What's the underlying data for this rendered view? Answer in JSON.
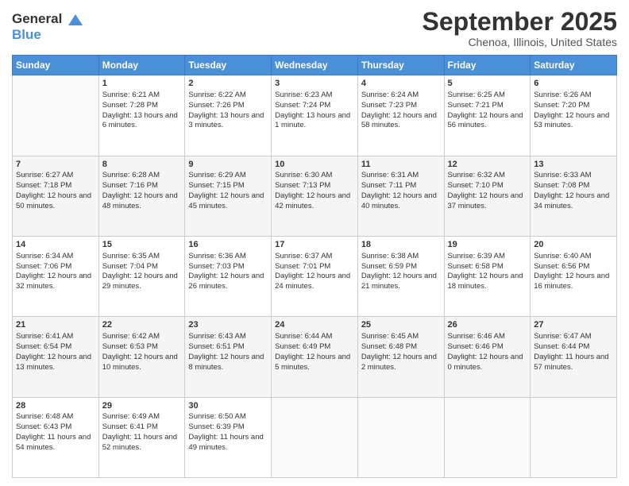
{
  "logo": {
    "line1": "General",
    "line2": "Blue"
  },
  "title": "September 2025",
  "subtitle": "Chenoa, Illinois, United States",
  "days": [
    "Sunday",
    "Monday",
    "Tuesday",
    "Wednesday",
    "Thursday",
    "Friday",
    "Saturday"
  ],
  "weeks": [
    [
      {
        "day": "",
        "sunrise": "",
        "sunset": "",
        "daylight": ""
      },
      {
        "day": "1",
        "sunrise": "Sunrise: 6:21 AM",
        "sunset": "Sunset: 7:28 PM",
        "daylight": "Daylight: 13 hours and 6 minutes."
      },
      {
        "day": "2",
        "sunrise": "Sunrise: 6:22 AM",
        "sunset": "Sunset: 7:26 PM",
        "daylight": "Daylight: 13 hours and 3 minutes."
      },
      {
        "day": "3",
        "sunrise": "Sunrise: 6:23 AM",
        "sunset": "Sunset: 7:24 PM",
        "daylight": "Daylight: 13 hours and 1 minute."
      },
      {
        "day": "4",
        "sunrise": "Sunrise: 6:24 AM",
        "sunset": "Sunset: 7:23 PM",
        "daylight": "Daylight: 12 hours and 58 minutes."
      },
      {
        "day": "5",
        "sunrise": "Sunrise: 6:25 AM",
        "sunset": "Sunset: 7:21 PM",
        "daylight": "Daylight: 12 hours and 56 minutes."
      },
      {
        "day": "6",
        "sunrise": "Sunrise: 6:26 AM",
        "sunset": "Sunset: 7:20 PM",
        "daylight": "Daylight: 12 hours and 53 minutes."
      }
    ],
    [
      {
        "day": "7",
        "sunrise": "Sunrise: 6:27 AM",
        "sunset": "Sunset: 7:18 PM",
        "daylight": "Daylight: 12 hours and 50 minutes."
      },
      {
        "day": "8",
        "sunrise": "Sunrise: 6:28 AM",
        "sunset": "Sunset: 7:16 PM",
        "daylight": "Daylight: 12 hours and 48 minutes."
      },
      {
        "day": "9",
        "sunrise": "Sunrise: 6:29 AM",
        "sunset": "Sunset: 7:15 PM",
        "daylight": "Daylight: 12 hours and 45 minutes."
      },
      {
        "day": "10",
        "sunrise": "Sunrise: 6:30 AM",
        "sunset": "Sunset: 7:13 PM",
        "daylight": "Daylight: 12 hours and 42 minutes."
      },
      {
        "day": "11",
        "sunrise": "Sunrise: 6:31 AM",
        "sunset": "Sunset: 7:11 PM",
        "daylight": "Daylight: 12 hours and 40 minutes."
      },
      {
        "day": "12",
        "sunrise": "Sunrise: 6:32 AM",
        "sunset": "Sunset: 7:10 PM",
        "daylight": "Daylight: 12 hours and 37 minutes."
      },
      {
        "day": "13",
        "sunrise": "Sunrise: 6:33 AM",
        "sunset": "Sunset: 7:08 PM",
        "daylight": "Daylight: 12 hours and 34 minutes."
      }
    ],
    [
      {
        "day": "14",
        "sunrise": "Sunrise: 6:34 AM",
        "sunset": "Sunset: 7:06 PM",
        "daylight": "Daylight: 12 hours and 32 minutes."
      },
      {
        "day": "15",
        "sunrise": "Sunrise: 6:35 AM",
        "sunset": "Sunset: 7:04 PM",
        "daylight": "Daylight: 12 hours and 29 minutes."
      },
      {
        "day": "16",
        "sunrise": "Sunrise: 6:36 AM",
        "sunset": "Sunset: 7:03 PM",
        "daylight": "Daylight: 12 hours and 26 minutes."
      },
      {
        "day": "17",
        "sunrise": "Sunrise: 6:37 AM",
        "sunset": "Sunset: 7:01 PM",
        "daylight": "Daylight: 12 hours and 24 minutes."
      },
      {
        "day": "18",
        "sunrise": "Sunrise: 6:38 AM",
        "sunset": "Sunset: 6:59 PM",
        "daylight": "Daylight: 12 hours and 21 minutes."
      },
      {
        "day": "19",
        "sunrise": "Sunrise: 6:39 AM",
        "sunset": "Sunset: 6:58 PM",
        "daylight": "Daylight: 12 hours and 18 minutes."
      },
      {
        "day": "20",
        "sunrise": "Sunrise: 6:40 AM",
        "sunset": "Sunset: 6:56 PM",
        "daylight": "Daylight: 12 hours and 16 minutes."
      }
    ],
    [
      {
        "day": "21",
        "sunrise": "Sunrise: 6:41 AM",
        "sunset": "Sunset: 6:54 PM",
        "daylight": "Daylight: 12 hours and 13 minutes."
      },
      {
        "day": "22",
        "sunrise": "Sunrise: 6:42 AM",
        "sunset": "Sunset: 6:53 PM",
        "daylight": "Daylight: 12 hours and 10 minutes."
      },
      {
        "day": "23",
        "sunrise": "Sunrise: 6:43 AM",
        "sunset": "Sunset: 6:51 PM",
        "daylight": "Daylight: 12 hours and 8 minutes."
      },
      {
        "day": "24",
        "sunrise": "Sunrise: 6:44 AM",
        "sunset": "Sunset: 6:49 PM",
        "daylight": "Daylight: 12 hours and 5 minutes."
      },
      {
        "day": "25",
        "sunrise": "Sunrise: 6:45 AM",
        "sunset": "Sunset: 6:48 PM",
        "daylight": "Daylight: 12 hours and 2 minutes."
      },
      {
        "day": "26",
        "sunrise": "Sunrise: 6:46 AM",
        "sunset": "Sunset: 6:46 PM",
        "daylight": "Daylight: 12 hours and 0 minutes."
      },
      {
        "day": "27",
        "sunrise": "Sunrise: 6:47 AM",
        "sunset": "Sunset: 6:44 PM",
        "daylight": "Daylight: 11 hours and 57 minutes."
      }
    ],
    [
      {
        "day": "28",
        "sunrise": "Sunrise: 6:48 AM",
        "sunset": "Sunset: 6:43 PM",
        "daylight": "Daylight: 11 hours and 54 minutes."
      },
      {
        "day": "29",
        "sunrise": "Sunrise: 6:49 AM",
        "sunset": "Sunset: 6:41 PM",
        "daylight": "Daylight: 11 hours and 52 minutes."
      },
      {
        "day": "30",
        "sunrise": "Sunrise: 6:50 AM",
        "sunset": "Sunset: 6:39 PM",
        "daylight": "Daylight: 11 hours and 49 minutes."
      },
      {
        "day": "",
        "sunrise": "",
        "sunset": "",
        "daylight": ""
      },
      {
        "day": "",
        "sunrise": "",
        "sunset": "",
        "daylight": ""
      },
      {
        "day": "",
        "sunrise": "",
        "sunset": "",
        "daylight": ""
      },
      {
        "day": "",
        "sunrise": "",
        "sunset": "",
        "daylight": ""
      }
    ]
  ]
}
